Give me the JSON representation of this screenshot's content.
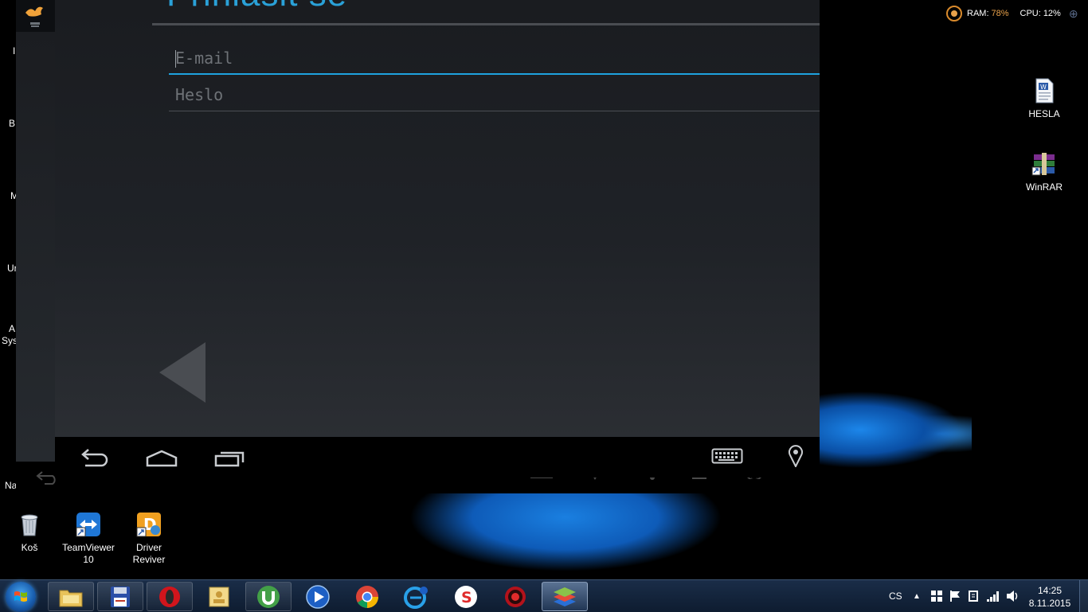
{
  "android_window": {
    "heading": "Přihlásit se",
    "email_placeholder": "E-mail",
    "password_placeholder": "Heslo"
  },
  "left_desktop_labels": [
    "I",
    "B",
    "M",
    "Ur",
    "A",
    "Syst",
    "Na"
  ],
  "system_monitor": {
    "ram_label": "RAM:",
    "ram_value": "78%",
    "cpu_label": "CPU:",
    "cpu_value": "12%",
    "accent_color": "#e8a14a"
  },
  "desktop_icons_right": [
    {
      "label": "HESLA",
      "icon": "word-document-icon"
    },
    {
      "label": "WinRAR",
      "icon": "winrar-icon"
    }
  ],
  "desktop_icons_bottom": [
    {
      "label": "Koš",
      "icon": "recycle-bin-icon"
    },
    {
      "label": "TeamViewer 10",
      "icon": "teamviewer-icon"
    },
    {
      "label": "Driver Reviver",
      "icon": "driver-reviver-icon"
    }
  ],
  "taskbar": {
    "apps": [
      {
        "name": "file-explorer",
        "icon": "folder-icon"
      },
      {
        "name": "save-app",
        "icon": "floppy-icon"
      },
      {
        "name": "opera",
        "icon": "opera-icon"
      },
      {
        "name": "contacts",
        "icon": "contacts-icon"
      },
      {
        "name": "utorrent",
        "icon": "utorrent-icon"
      },
      {
        "name": "media-player",
        "icon": "play-icon"
      },
      {
        "name": "chrome",
        "icon": "chrome-icon"
      },
      {
        "name": "browser-e",
        "icon": "e-browser-icon"
      },
      {
        "name": "s-app",
        "icon": "s-app-icon"
      },
      {
        "name": "game-app",
        "icon": "gear-red-icon"
      },
      {
        "name": "bluestacks",
        "icon": "bluestacks-icon"
      }
    ],
    "language": "CS",
    "time": "14:25",
    "date": "8.11.2015"
  }
}
